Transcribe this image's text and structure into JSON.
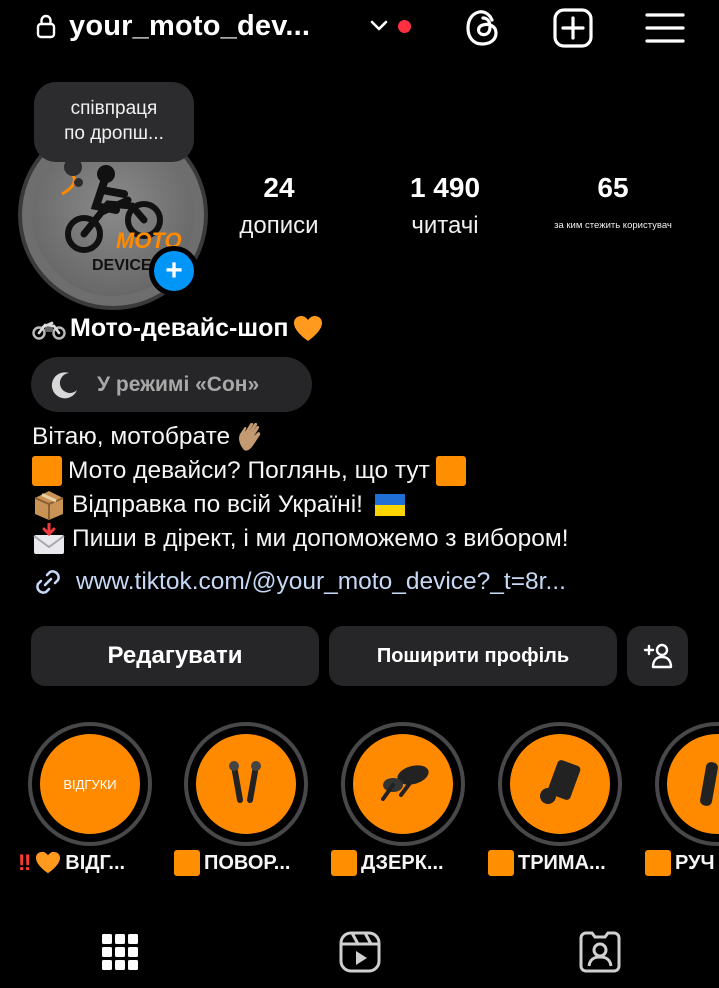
{
  "header": {
    "username": "your_moto_dev...",
    "icons": [
      "lock-icon",
      "chevron-down-icon",
      "threads-icon",
      "new-post-icon",
      "menu-icon"
    ]
  },
  "note": {
    "text_line1": "співпраця",
    "text_line2": "по дропш..."
  },
  "avatar": {
    "logo_text_top": "MOTO",
    "logo_text_bottom": "DEVICE",
    "add_icon": "+"
  },
  "stats": [
    {
      "value": "24",
      "label": "дописи"
    },
    {
      "value": "1 490",
      "label": "читачі"
    },
    {
      "value": "65",
      "label": "за ким стежить користувач"
    }
  ],
  "profile": {
    "name": "Мото-девайс-шоп",
    "sleep_mode": "У режимі «Сон»",
    "bio": [
      "Вітаю, мотобрате",
      "Мото девайси? Поглянь, що тут",
      "Відправка по всій Україні!",
      "Пиши в дірект, і ми допоможемо з вибором!"
    ],
    "link": "www.tiktok.com/@your_moto_device?_t=8r..."
  },
  "buttons": {
    "edit": "Редагувати",
    "share": "Поширити профіль",
    "add_person_icon": "add-person-icon"
  },
  "highlights": [
    {
      "cover_text": "ВІДГУКИ",
      "label": "ВІДГ..."
    },
    {
      "cover_text": "",
      "label": "ПОВОР..."
    },
    {
      "cover_text": "",
      "label": "ДЗЕРК..."
    },
    {
      "cover_text": "",
      "label": "ТРИМА..."
    },
    {
      "cover_text": "",
      "label": "РУЧ"
    }
  ],
  "tabs": [
    "grid-icon",
    "reels-icon",
    "tagged-icon"
  ],
  "colors": {
    "accent_blue": "#0095f6",
    "highlight_orange": "#ff8a00",
    "background": "#000000",
    "notification_red": "#ff3040"
  }
}
